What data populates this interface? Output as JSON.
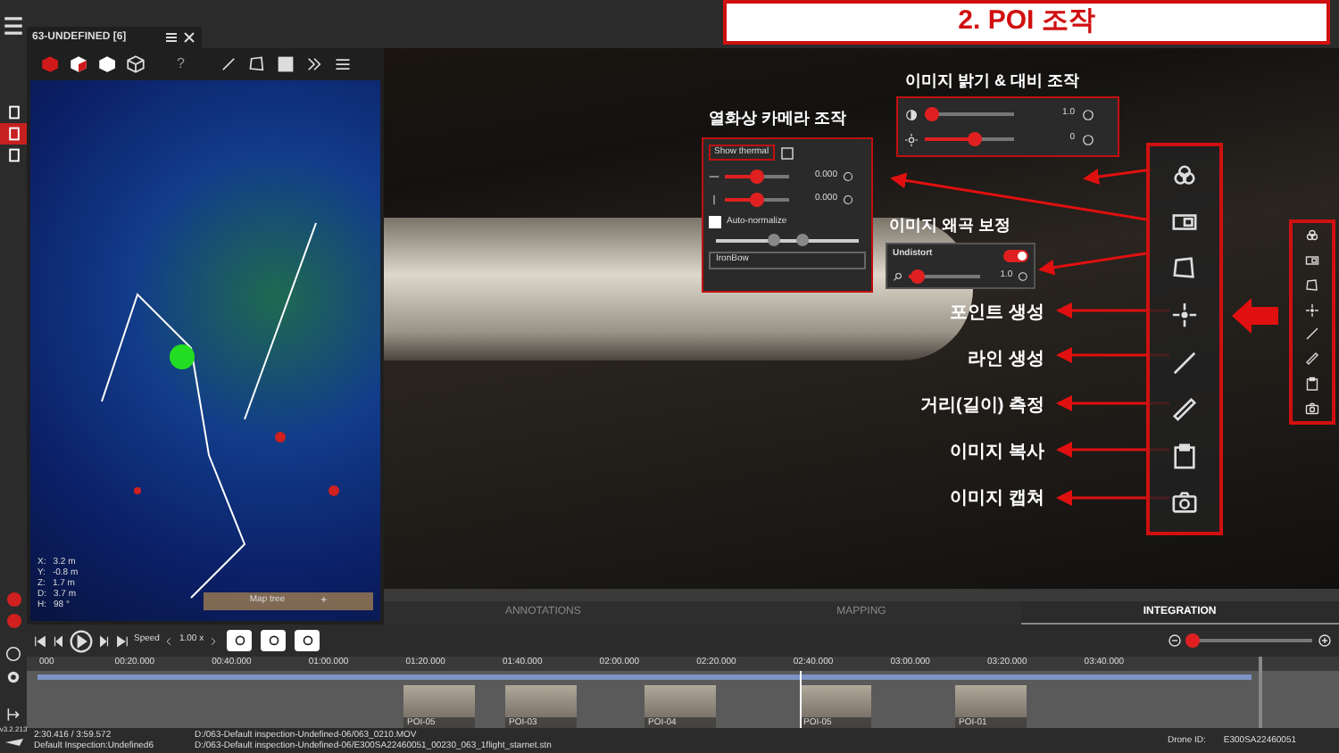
{
  "banner": {
    "title": "2. POI 조작"
  },
  "project_tab": {
    "title": "63-UNDEFINED [6]"
  },
  "left_toolbar": {
    "help": "?"
  },
  "coordinates": [
    {
      "axis": "X:",
      "value": "3.2 m"
    },
    {
      "axis": "Y:",
      "value": "-0.8 m"
    },
    {
      "axis": "Z:",
      "value": "1.7 m"
    },
    {
      "axis": "D:",
      "value": "3.7 m"
    },
    {
      "axis": "H:",
      "value": "98 °"
    }
  ],
  "map_tree": {
    "label": "Map tree",
    "action": "+"
  },
  "thermal_panel": {
    "title": "열화상 카메라 조작",
    "toggle": "Show thermal",
    "sliders": [
      {
        "level": 0.5,
        "value": "0.000"
      },
      {
        "level": 0.5,
        "value": "0.000"
      }
    ],
    "auto_normalize": {
      "label": "Auto-normalize",
      "checked": false
    },
    "range_thumbs": [
      {
        "level": 0.4
      },
      {
        "level": 0.6
      }
    ],
    "palette": "IronBow"
  },
  "brightness_panel": {
    "title": "이미지 밝기 & 대비 조작",
    "sliders": [
      {
        "level": 0.08,
        "value": "1.0"
      },
      {
        "level": 0.55,
        "value": "0"
      }
    ]
  },
  "undistort_panel": {
    "title": "이미지 왜곡 보정",
    "toggle": {
      "label": "Undistort",
      "on": true
    },
    "slider": {
      "level": 0.12,
      "value": "1.0"
    }
  },
  "tool_labels": [
    "포인트 생성",
    "라인 생성",
    "거리(길이) 측정",
    "이미지 복사",
    "이미지 캡쳐"
  ],
  "tabs": [
    {
      "label": "ANNOTATIONS",
      "selected": false
    },
    {
      "label": "MAPPING",
      "selected": false
    },
    {
      "label": "INTEGRATION",
      "selected": true
    }
  ],
  "player": {
    "speed_label": "Speed",
    "speed": "1.00 x"
  },
  "zoom_slider": {
    "level": 0.04
  },
  "timeline": {
    "ticks": [
      "000",
      "00:20.000",
      "00:40.000",
      "01:00.000",
      "01:20.000",
      "01:40.000",
      "02:00.000",
      "02:20.000",
      "02:40.000",
      "03:00.000",
      "03:20.000",
      "03:40.000"
    ],
    "pois": [
      {
        "label": "POI-05"
      },
      {
        "label": "POI-03"
      },
      {
        "label": "POI-04"
      },
      {
        "label": "POI-05"
      },
      {
        "label": "POI-01"
      }
    ]
  },
  "version": "v3.2.213",
  "status": {
    "time": "2:30.416 / 3:59.572",
    "inspection": "Default Inspection:Undefined6",
    "video_path": "D:/063-Default inspection-Undefined-06/063_0210.MOV",
    "stn_path": "D:/063-Default inspection-Undefined-06/E300SA22460051_00230_063_1flight_starnet.stn",
    "drone_label": "Drone ID:",
    "drone_id": "E300SA22460051"
  }
}
